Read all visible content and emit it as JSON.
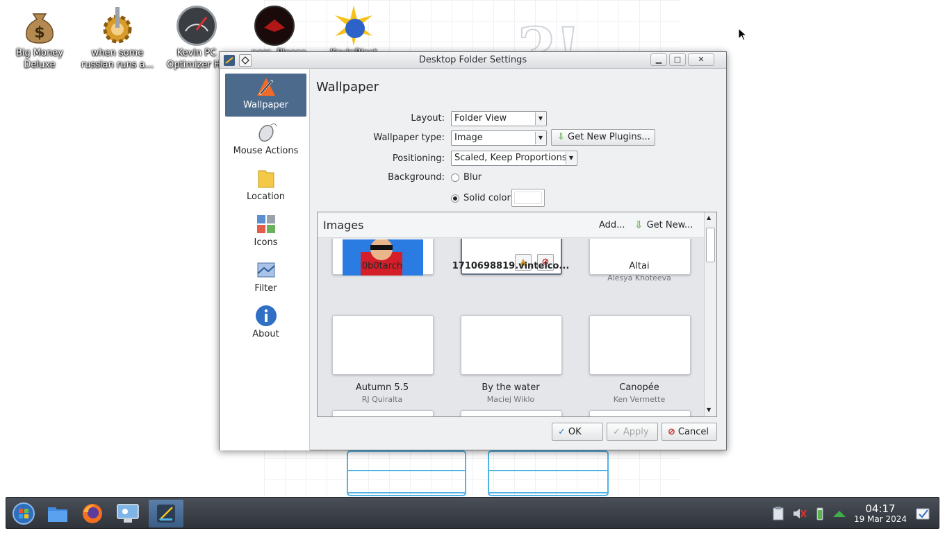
{
  "desktop": {
    "icons": [
      {
        "label": "Big Money Deluxe",
        "icon": "money-bag-icon"
      },
      {
        "label": "when some russian runs a...",
        "icon": "gear-icon"
      },
      {
        "label": "Kevin PC Optimizer Hd",
        "icon": "speedometer-icon"
      },
      {
        "label": "...pers, Please",
        "icon": "red-emblem-icon"
      },
      {
        "label": "KevinBlast",
        "icon": "blast-globe-icon"
      }
    ]
  },
  "window": {
    "title": "Desktop Folder Settings",
    "controls": {
      "minimize": "▁",
      "maximize": "□",
      "close": "✕"
    }
  },
  "sidebar": {
    "items": [
      {
        "label": "Wallpaper",
        "icon": "wallpaper-icon",
        "active": true
      },
      {
        "label": "Mouse Actions",
        "icon": "mouse-icon",
        "active": false
      },
      {
        "label": "Location",
        "icon": "folder-icon",
        "active": false
      },
      {
        "label": "Icons",
        "icon": "icons-icon",
        "active": false
      },
      {
        "label": "Filter",
        "icon": "filter-icon",
        "active": false
      },
      {
        "label": "About",
        "icon": "info-icon",
        "active": false
      }
    ]
  },
  "main": {
    "heading": "Wallpaper",
    "layout": {
      "label": "Layout:",
      "value": "Folder View"
    },
    "wallpaper_type": {
      "label": "Wallpaper type:",
      "value": "Image",
      "plugins_button": "Get New Plugins..."
    },
    "positioning": {
      "label": "Positioning:",
      "value": "Scaled, Keep Proportions"
    },
    "background": {
      "label": "Background:",
      "options": [
        {
          "label": "Blur",
          "selected": false
        },
        {
          "label": "Solid color",
          "selected": true
        }
      ],
      "color": "#ffffff"
    },
    "images": {
      "title": "Images",
      "add_label": "Add...",
      "get_new_label": "Get New...",
      "items": [
        {
          "name": "0b0tarch",
          "author": "",
          "selected": false
        },
        {
          "name": "1710698819.vintelco...",
          "author": "",
          "selected": true
        },
        {
          "name": "Altai",
          "author": "Alesya Khoteeva",
          "selected": false
        },
        {
          "name": "Autumn 5.5",
          "author": "RJ Quiralta",
          "selected": false
        },
        {
          "name": "By the water",
          "author": "Maciej Wiklo",
          "selected": false
        },
        {
          "name": "Canopée",
          "author": "Ken Vermette",
          "selected": false
        }
      ]
    }
  },
  "buttons": {
    "ok": "OK",
    "apply": "Apply",
    "cancel": "Cancel"
  },
  "taskbar": {
    "apps": [
      "start-menu-icon",
      "file-manager-icon",
      "firefox-icon",
      "system-settings-icon",
      "desktop-settings-icon"
    ],
    "time": "04:17",
    "date": "19 Mar 2024"
  }
}
